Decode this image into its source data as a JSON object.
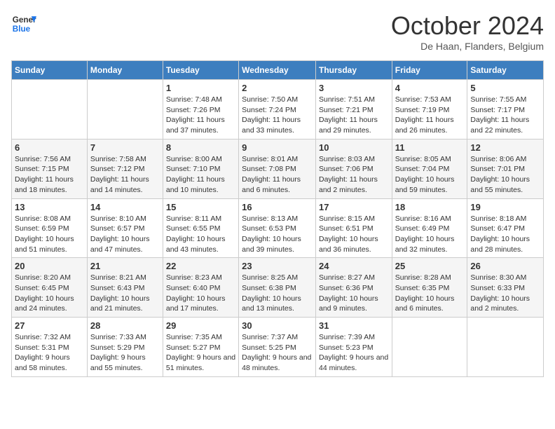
{
  "header": {
    "logo_line1": "General",
    "logo_line2": "Blue",
    "month_title": "October 2024",
    "subtitle": "De Haan, Flanders, Belgium"
  },
  "days_of_week": [
    "Sunday",
    "Monday",
    "Tuesday",
    "Wednesday",
    "Thursday",
    "Friday",
    "Saturday"
  ],
  "weeks": [
    [
      {
        "day": "",
        "info": ""
      },
      {
        "day": "",
        "info": ""
      },
      {
        "day": "1",
        "info": "Sunrise: 7:48 AM\nSunset: 7:26 PM\nDaylight: 11 hours and 37 minutes."
      },
      {
        "day": "2",
        "info": "Sunrise: 7:50 AM\nSunset: 7:24 PM\nDaylight: 11 hours and 33 minutes."
      },
      {
        "day": "3",
        "info": "Sunrise: 7:51 AM\nSunset: 7:21 PM\nDaylight: 11 hours and 29 minutes."
      },
      {
        "day": "4",
        "info": "Sunrise: 7:53 AM\nSunset: 7:19 PM\nDaylight: 11 hours and 26 minutes."
      },
      {
        "day": "5",
        "info": "Sunrise: 7:55 AM\nSunset: 7:17 PM\nDaylight: 11 hours and 22 minutes."
      }
    ],
    [
      {
        "day": "6",
        "info": "Sunrise: 7:56 AM\nSunset: 7:15 PM\nDaylight: 11 hours and 18 minutes."
      },
      {
        "day": "7",
        "info": "Sunrise: 7:58 AM\nSunset: 7:12 PM\nDaylight: 11 hours and 14 minutes."
      },
      {
        "day": "8",
        "info": "Sunrise: 8:00 AM\nSunset: 7:10 PM\nDaylight: 11 hours and 10 minutes."
      },
      {
        "day": "9",
        "info": "Sunrise: 8:01 AM\nSunset: 7:08 PM\nDaylight: 11 hours and 6 minutes."
      },
      {
        "day": "10",
        "info": "Sunrise: 8:03 AM\nSunset: 7:06 PM\nDaylight: 11 hours and 2 minutes."
      },
      {
        "day": "11",
        "info": "Sunrise: 8:05 AM\nSunset: 7:04 PM\nDaylight: 10 hours and 59 minutes."
      },
      {
        "day": "12",
        "info": "Sunrise: 8:06 AM\nSunset: 7:01 PM\nDaylight: 10 hours and 55 minutes."
      }
    ],
    [
      {
        "day": "13",
        "info": "Sunrise: 8:08 AM\nSunset: 6:59 PM\nDaylight: 10 hours and 51 minutes."
      },
      {
        "day": "14",
        "info": "Sunrise: 8:10 AM\nSunset: 6:57 PM\nDaylight: 10 hours and 47 minutes."
      },
      {
        "day": "15",
        "info": "Sunrise: 8:11 AM\nSunset: 6:55 PM\nDaylight: 10 hours and 43 minutes."
      },
      {
        "day": "16",
        "info": "Sunrise: 8:13 AM\nSunset: 6:53 PM\nDaylight: 10 hours and 39 minutes."
      },
      {
        "day": "17",
        "info": "Sunrise: 8:15 AM\nSunset: 6:51 PM\nDaylight: 10 hours and 36 minutes."
      },
      {
        "day": "18",
        "info": "Sunrise: 8:16 AM\nSunset: 6:49 PM\nDaylight: 10 hours and 32 minutes."
      },
      {
        "day": "19",
        "info": "Sunrise: 8:18 AM\nSunset: 6:47 PM\nDaylight: 10 hours and 28 minutes."
      }
    ],
    [
      {
        "day": "20",
        "info": "Sunrise: 8:20 AM\nSunset: 6:45 PM\nDaylight: 10 hours and 24 minutes."
      },
      {
        "day": "21",
        "info": "Sunrise: 8:21 AM\nSunset: 6:43 PM\nDaylight: 10 hours and 21 minutes."
      },
      {
        "day": "22",
        "info": "Sunrise: 8:23 AM\nSunset: 6:40 PM\nDaylight: 10 hours and 17 minutes."
      },
      {
        "day": "23",
        "info": "Sunrise: 8:25 AM\nSunset: 6:38 PM\nDaylight: 10 hours and 13 minutes."
      },
      {
        "day": "24",
        "info": "Sunrise: 8:27 AM\nSunset: 6:36 PM\nDaylight: 10 hours and 9 minutes."
      },
      {
        "day": "25",
        "info": "Sunrise: 8:28 AM\nSunset: 6:35 PM\nDaylight: 10 hours and 6 minutes."
      },
      {
        "day": "26",
        "info": "Sunrise: 8:30 AM\nSunset: 6:33 PM\nDaylight: 10 hours and 2 minutes."
      }
    ],
    [
      {
        "day": "27",
        "info": "Sunrise: 7:32 AM\nSunset: 5:31 PM\nDaylight: 9 hours and 58 minutes."
      },
      {
        "day": "28",
        "info": "Sunrise: 7:33 AM\nSunset: 5:29 PM\nDaylight: 9 hours and 55 minutes."
      },
      {
        "day": "29",
        "info": "Sunrise: 7:35 AM\nSunset: 5:27 PM\nDaylight: 9 hours and 51 minutes."
      },
      {
        "day": "30",
        "info": "Sunrise: 7:37 AM\nSunset: 5:25 PM\nDaylight: 9 hours and 48 minutes."
      },
      {
        "day": "31",
        "info": "Sunrise: 7:39 AM\nSunset: 5:23 PM\nDaylight: 9 hours and 44 minutes."
      },
      {
        "day": "",
        "info": ""
      },
      {
        "day": "",
        "info": ""
      }
    ]
  ]
}
